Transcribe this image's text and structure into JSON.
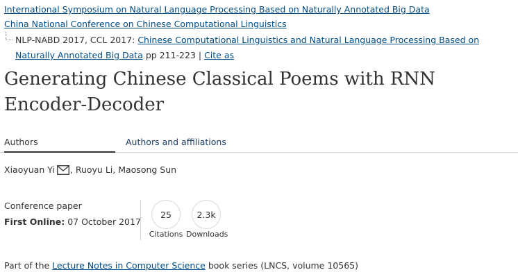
{
  "breadcrumb": {
    "symposium": "International Symposium on Natural Language Processing Based on Naturally Annotated Big Data",
    "conference": "China National Conference on Chinese Computational Linguistics",
    "series_prefix": "NLP-NABD 2017, CCL 2017: ",
    "book_title": "Chinese Computational Linguistics and Natural Language Processing Based on Naturally Annotated Big Data",
    "pages": " pp 211-223 | ",
    "cite_as": "Cite as"
  },
  "article": {
    "title": "Generating Chinese Classical Poems with RNN Encoder-Decoder"
  },
  "tabs": [
    {
      "label": "Authors",
      "active": true
    },
    {
      "label": "Authors and affiliations",
      "active": false
    }
  ],
  "authors": {
    "first": "Xiaoyuan Yi",
    "rest": ", Ruoyu Li, Maosong Sun",
    "icon": "mail-icon"
  },
  "meta": {
    "type": "Conference paper",
    "first_online_label": "First Online:",
    "first_online_date": " 07 October 2017"
  },
  "metrics": {
    "citations_value": "25",
    "citations_label": "Citations",
    "downloads_value": "2.3k",
    "downloads_label": "Downloads"
  },
  "part_of": {
    "prefix": "Part of the ",
    "series_link": "Lecture Notes in Computer Science",
    "suffix": " book series (LNCS, volume 10565)"
  },
  "colors": {
    "link": "#004b83",
    "text": "#333333",
    "divider": "#d5d5d5"
  }
}
